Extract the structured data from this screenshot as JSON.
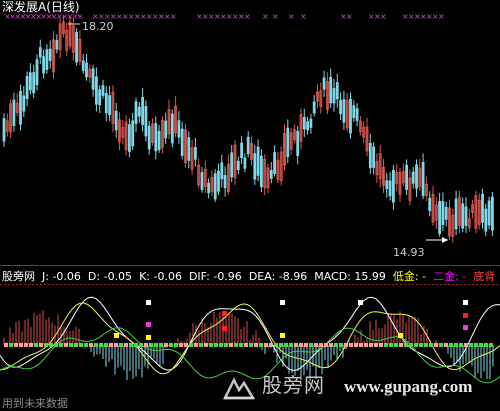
{
  "title": "深发展A(日线)",
  "price_high_label": "18.20",
  "price_low_label": "14.93",
  "indicator_row": [
    {
      "text": "股旁网",
      "color": "#ffffff"
    },
    {
      "text": "J: -0.06",
      "color": "#ffffff"
    },
    {
      "text": "D: -0.05",
      "color": "#ffffff"
    },
    {
      "text": "K: -0.06",
      "color": "#ffffff"
    },
    {
      "text": "DIF: -0.96",
      "color": "#ffffff"
    },
    {
      "text": "DEA: -8.96",
      "color": "#ffffff"
    },
    {
      "text": "MACD: 15.99",
      "color": "#ffffff"
    },
    {
      "text": "低金: -",
      "color": "#ffff00"
    },
    {
      "text": "二金: -",
      "color": "#ff00ff"
    },
    {
      "text": "底背",
      "color": "#ff4040"
    }
  ],
  "footer_text": "用到未来数据",
  "watermark_text": "股旁网",
  "watermark_url": "www.gupang.com",
  "colors": {
    "up": "#e0574f",
    "down": "#7fd8e6",
    "marker": "#e040e0",
    "line_white": "#ffffff",
    "line_yellow": "#f0f060",
    "line_green": "#40d040",
    "hist_red": "#d85050",
    "hist_cyan": "#7fd8e6"
  },
  "chart_data": {
    "type": "candlestick",
    "price_high": 18.2,
    "price_low": 14.93
  }
}
